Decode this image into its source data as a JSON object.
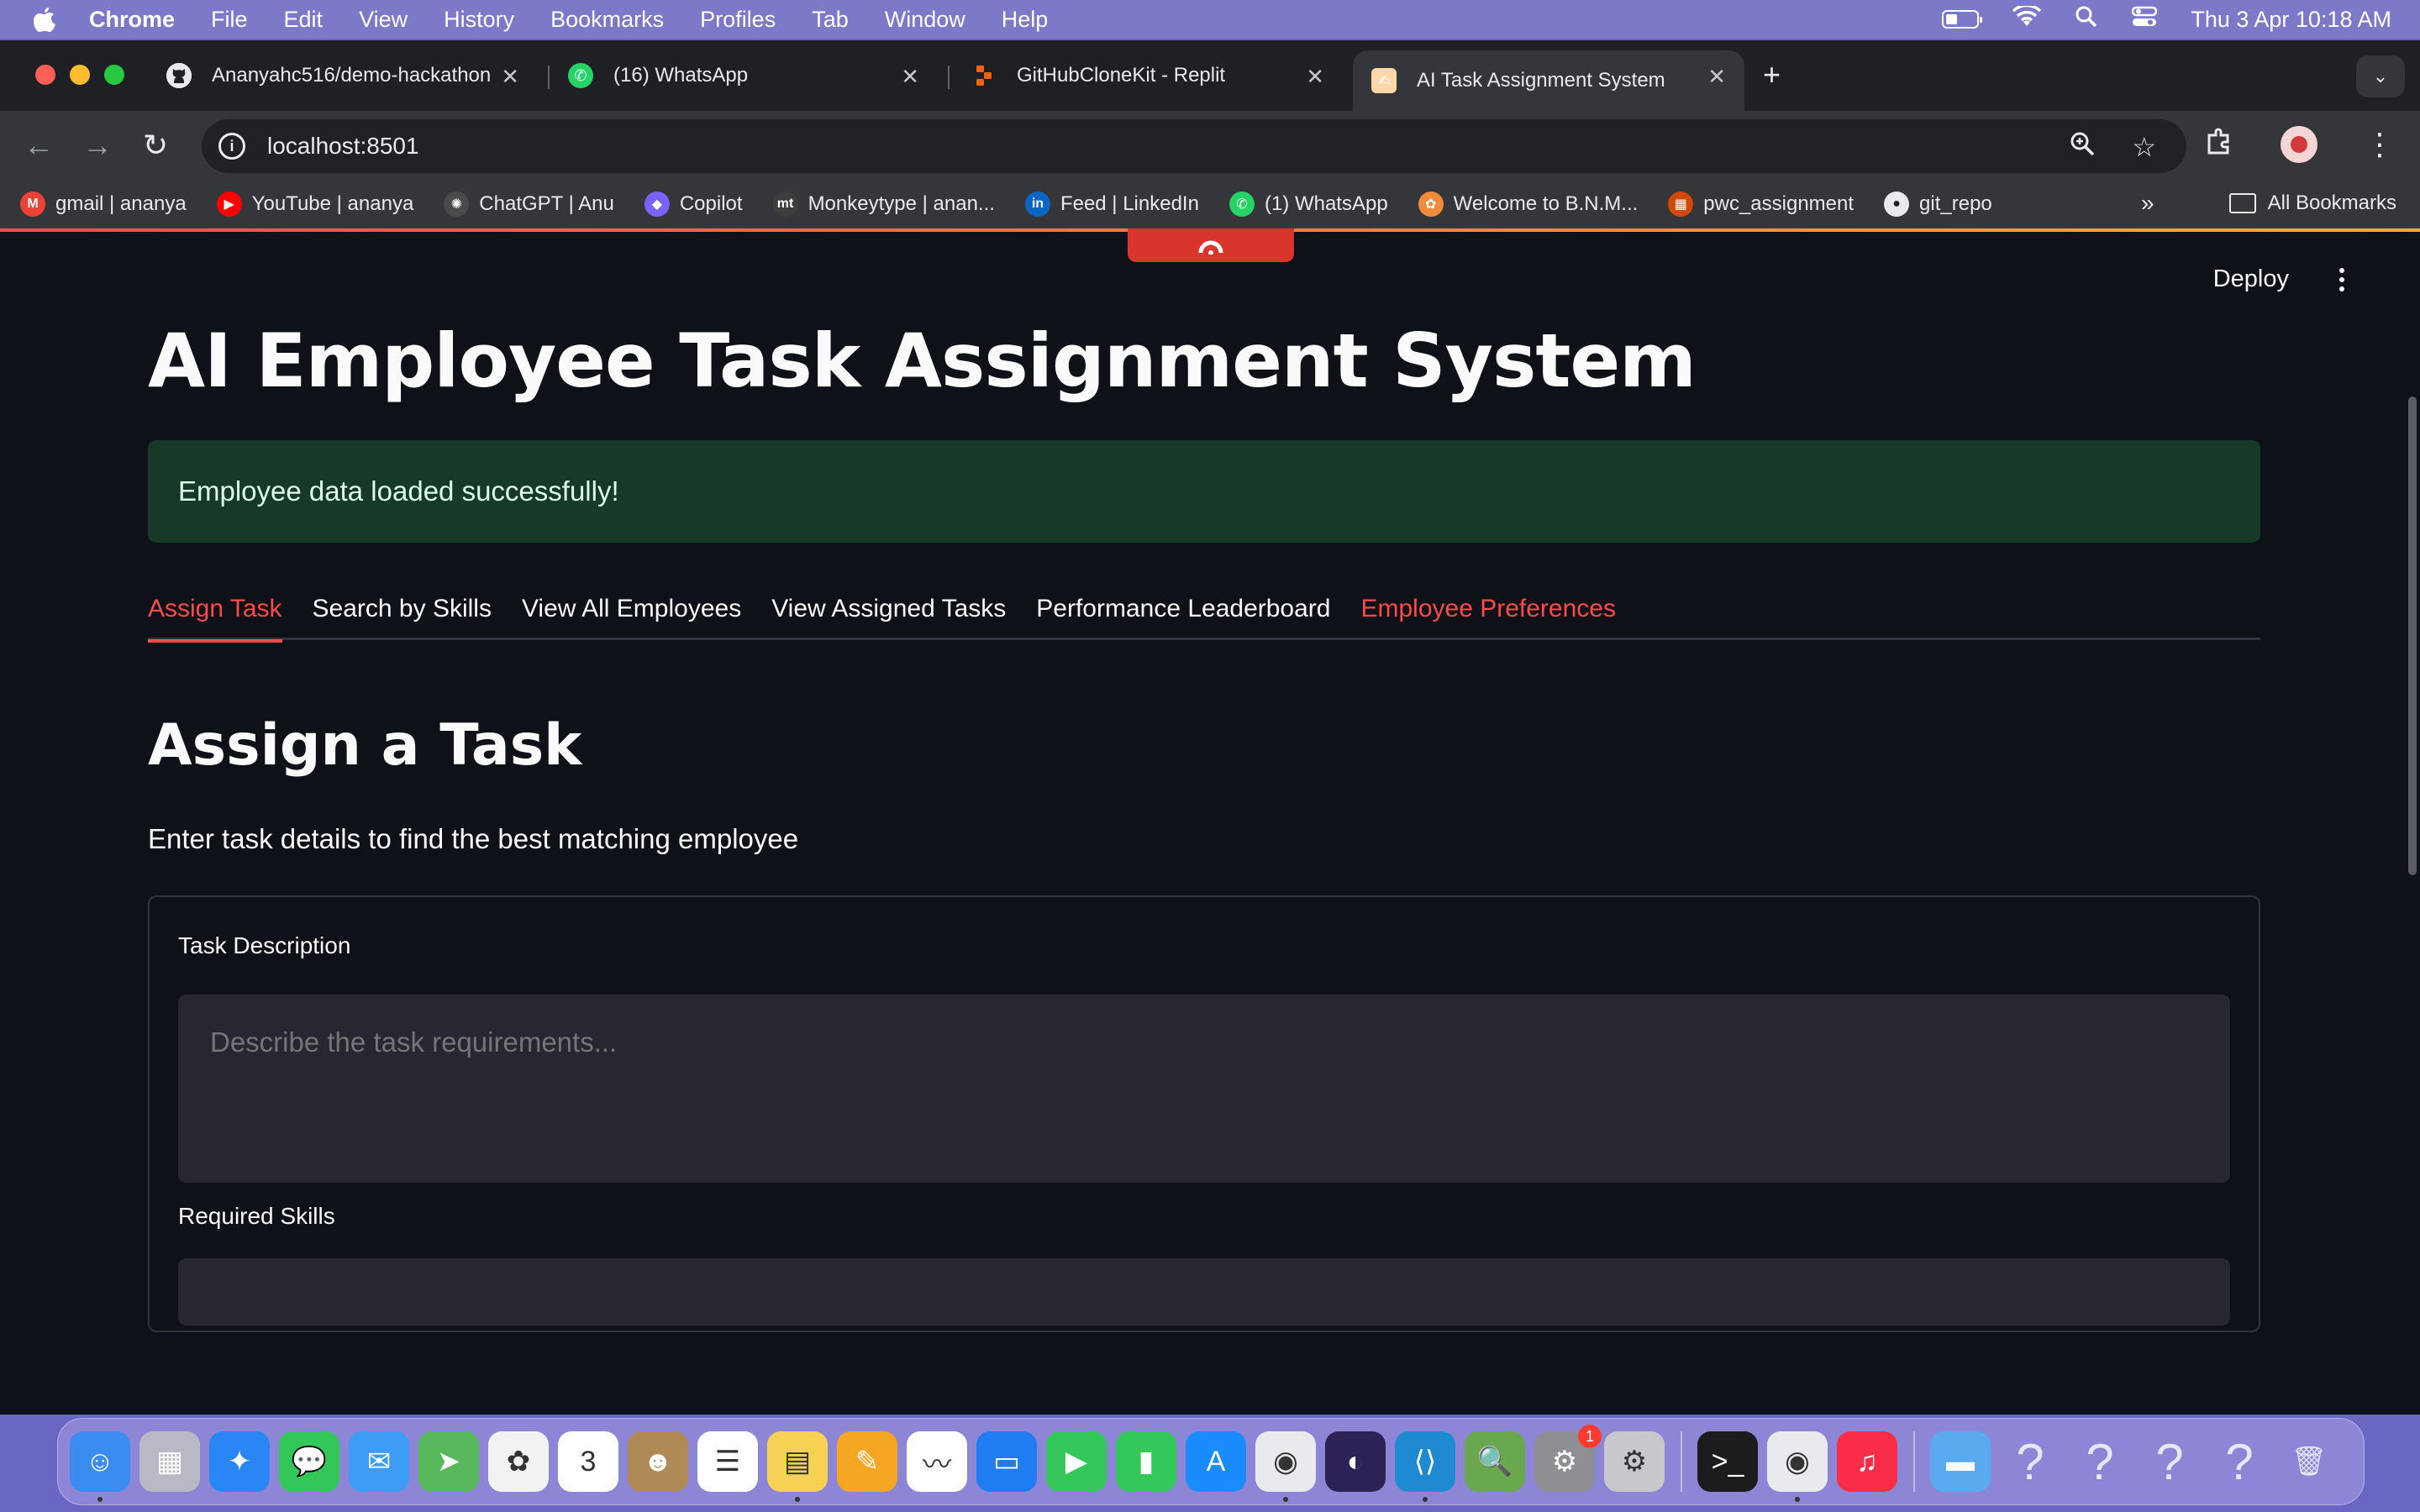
{
  "menubar": {
    "app": "Chrome",
    "items": [
      "File",
      "Edit",
      "View",
      "History",
      "Bookmarks",
      "Profiles",
      "Tab",
      "Window",
      "Help"
    ],
    "clock": "Thu 3 Apr  10:18 AM",
    "battery_level": 0.35
  },
  "browser": {
    "tabs": [
      {
        "title": "Ananyahc516/demo-hackathon",
        "icon": "github-icon",
        "color": "#e8eaed"
      },
      {
        "title": "(16) WhatsApp",
        "icon": "whatsapp-icon",
        "color": "#25d366"
      },
      {
        "title": "GitHubCloneKit - Replit",
        "icon": "replit-icon",
        "color": "#f26207"
      },
      {
        "title": "AI Task Assignment System",
        "icon": "streamlit-icon",
        "color": "#ff4b4b"
      }
    ],
    "address": "localhost:8501",
    "bookmarks": [
      {
        "label": "gmail | ananya",
        "icon": "gmail-icon",
        "color": "#ea4335",
        "glyph": "M"
      },
      {
        "label": "YouTube | ananya",
        "icon": "youtube-icon",
        "color": "#ff0000",
        "glyph": "▶"
      },
      {
        "label": "ChatGPT | Anu",
        "icon": "chatgpt-icon",
        "color": "#4a4a4a",
        "glyph": "✺"
      },
      {
        "label": "Copilot",
        "icon": "copilot-icon",
        "color": "#7b61ff",
        "glyph": "◆"
      },
      {
        "label": "Monkeytype | anan...",
        "icon": "monkeytype-icon",
        "color": "#3d3d3d",
        "glyph": "mt"
      },
      {
        "label": "Feed | LinkedIn",
        "icon": "linkedin-icon",
        "color": "#0a66c2",
        "glyph": "in"
      },
      {
        "label": "(1) WhatsApp",
        "icon": "whatsapp-icon",
        "color": "#25d366",
        "glyph": "✆"
      },
      {
        "label": "Welcome to B.N.M...",
        "icon": "college-icon",
        "color": "#f08a3c",
        "glyph": "✿"
      },
      {
        "label": "pwc_assignment",
        "icon": "pwc-icon",
        "color": "#d04a02",
        "glyph": "▦"
      },
      {
        "label": "git_repo",
        "icon": "github-icon",
        "color": "#e8eaed",
        "glyph": "●"
      }
    ],
    "all_bookmarks": "All Bookmarks"
  },
  "app": {
    "deploy_label": "Deploy",
    "title": "AI Employee Task Assignment System",
    "success_message": "Employee data loaded successfully!",
    "tabs": [
      "Assign Task",
      "Search by Skills",
      "View All Employees",
      "View Assigned Tasks",
      "Performance Leaderboard",
      "Employee Preferences"
    ],
    "section_title": "Assign a Task",
    "section_lead": "Enter task details to find the best matching employee",
    "form": {
      "task_description_label": "Task Description",
      "task_description_placeholder": "Describe the task requirements...",
      "required_skills_label": "Required Skills"
    }
  },
  "dock": [
    {
      "name": "finder-icon",
      "color": "#3b8cf0",
      "glyph": "☺"
    },
    {
      "name": "launchpad-icon",
      "color": "#b9b9c6",
      "glyph": "▦"
    },
    {
      "name": "safari-icon",
      "color": "#2a86f5",
      "glyph": "✦"
    },
    {
      "name": "messages-icon",
      "color": "#33c759",
      "glyph": "💬"
    },
    {
      "name": "mail-icon",
      "color": "#3d9cf5",
      "glyph": "✉"
    },
    {
      "name": "maps-icon",
      "color": "#58b85c",
      "glyph": "➤"
    },
    {
      "name": "photos-icon",
      "color": "#f2f2f2",
      "glyph": "✿"
    },
    {
      "name": "calendar-icon",
      "color": "#ffffff",
      "glyph": "3"
    },
    {
      "name": "contacts-icon",
      "color": "#b08a55",
      "glyph": "☻"
    },
    {
      "name": "reminders-icon",
      "color": "#ffffff",
      "glyph": "☰"
    },
    {
      "name": "notes-icon",
      "color": "#f7d154",
      "glyph": "▤"
    },
    {
      "name": "pages-icon",
      "color": "#f5a623",
      "glyph": "✎"
    },
    {
      "name": "freeform-icon",
      "color": "#ffffff",
      "glyph": "〰"
    },
    {
      "name": "keynote-icon",
      "color": "#1f7cf2",
      "glyph": "▭"
    },
    {
      "name": "facetime-icon",
      "color": "#35c759",
      "glyph": "▶"
    },
    {
      "name": "numbers-icon",
      "color": "#34c759",
      "glyph": "▮"
    },
    {
      "name": "app-store-icon",
      "color": "#1a8cff",
      "glyph": "A"
    },
    {
      "name": "chrome-icon",
      "color": "#e8eaed",
      "glyph": "◉"
    },
    {
      "name": "eclipse-icon",
      "color": "#2c2255",
      "glyph": "◐"
    },
    {
      "name": "vscode-icon",
      "color": "#1f8ad2",
      "glyph": "⟨⟩"
    },
    {
      "name": "preview-icon",
      "color": "#6aa84f",
      "glyph": "🔍"
    },
    {
      "name": "system-settings-icon",
      "color": "#8e8e93",
      "glyph": "⚙",
      "badge": "1"
    },
    {
      "name": "settings-icon",
      "color": "#c7c7cc",
      "glyph": "⚙"
    },
    {
      "name": "terminal-icon",
      "color": "#1c1c1e",
      "glyph": ">_"
    },
    {
      "name": "chrome-icon",
      "color": "#e8eaed",
      "glyph": "◉"
    },
    {
      "name": "music-icon",
      "color": "#fa2d48",
      "glyph": "♫"
    },
    {
      "name": "folder-icon",
      "color": "#5aaaf0",
      "glyph": "▬"
    },
    {
      "name": "unknown-app-icon",
      "color": "transparent",
      "glyph": "?"
    },
    {
      "name": "unknown-app-icon",
      "color": "transparent",
      "glyph": "?"
    },
    {
      "name": "unknown-app-icon",
      "color": "transparent",
      "glyph": "?"
    },
    {
      "name": "unknown-app-icon",
      "color": "transparent",
      "glyph": "?"
    },
    {
      "name": "trash-icon",
      "color": "transparent",
      "glyph": "🗑"
    }
  ]
}
